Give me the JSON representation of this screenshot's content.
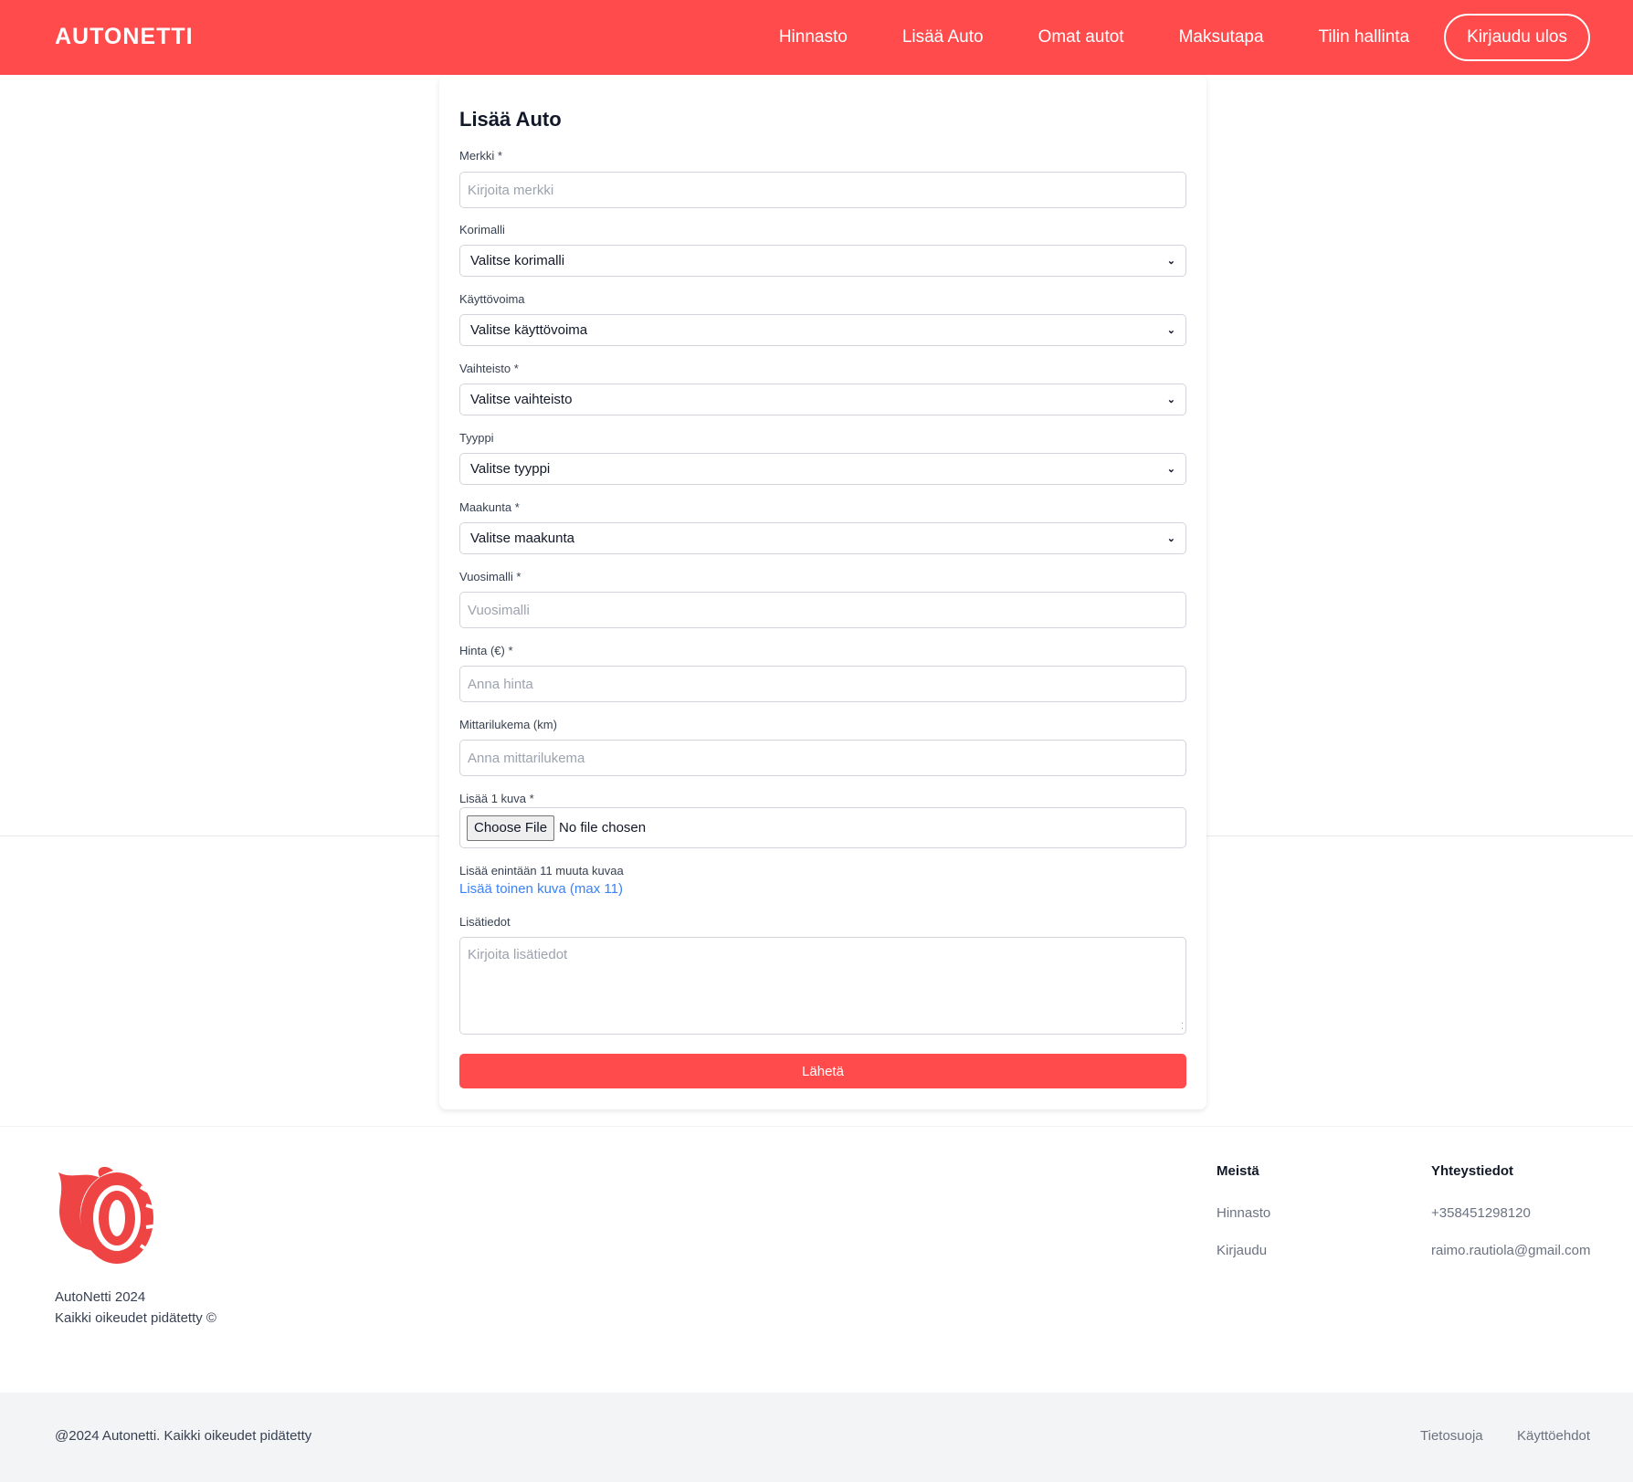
{
  "brand": "AUTONETTI",
  "nav": {
    "links": [
      "Hinnasto",
      "Lisää Auto",
      "Omat autot",
      "Maksutapa",
      "Tilin hallinta"
    ],
    "logout": "Kirjaudu ulos"
  },
  "form": {
    "title": "Lisää Auto",
    "make": {
      "label": "Merkki *",
      "placeholder": "Kirjoita merkki"
    },
    "body_type": {
      "label": "Korimalli",
      "value": "Valitse korimalli"
    },
    "fuel": {
      "label": "Käyttövoima",
      "value": "Valitse käyttövoima"
    },
    "gearbox": {
      "label": "Vaihteisto *",
      "value": "Valitse vaihteisto"
    },
    "type": {
      "label": "Tyyppi",
      "value": "Valitse tyyppi"
    },
    "region": {
      "label": "Maakunta *",
      "value": "Valitse maakunta"
    },
    "year": {
      "label": "Vuosimalli *",
      "placeholder": "Vuosimalli"
    },
    "price": {
      "label": "Hinta (€) *",
      "placeholder": "Anna hinta"
    },
    "mileage": {
      "label": "Mittarilukema (km)",
      "placeholder": "Anna mittarilukema"
    },
    "image": {
      "label": "Lisää 1 kuva *",
      "button": "Choose File",
      "status": "No file chosen"
    },
    "more_images_note": "Lisää enintään 11 muuta kuvaa",
    "add_image_link": "Lisää toinen kuva (max 11)",
    "details": {
      "label": "Lisätiedot",
      "placeholder": "Kirjoita lisätiedot"
    },
    "submit": "Lähetä"
  },
  "footer": {
    "brand_line1": "AutoNetti 2024",
    "brand_line2": "Kaikki oikeudet pidätetty ©",
    "about": {
      "heading": "Meistä",
      "links": [
        "Hinnasto",
        "Kirjaudu"
      ]
    },
    "contact": {
      "heading": "Yhteystiedot",
      "phone": "+358451298120",
      "email": "raimo.rautiola@gmail.com"
    },
    "copyright": "@2024 Autonetti. Kaikki oikeudet pidätetty",
    "legal": [
      "Tietosuoja",
      "Käyttöehdot"
    ]
  },
  "colors": {
    "accent": "#ff4b4b",
    "link": "#3b82f6",
    "bottom_bar": "#f3f4f6"
  },
  "icons": {
    "logo": "flaming-tire-icon",
    "select": "chevron-down-icon",
    "resize": "resize-grip-icon"
  }
}
